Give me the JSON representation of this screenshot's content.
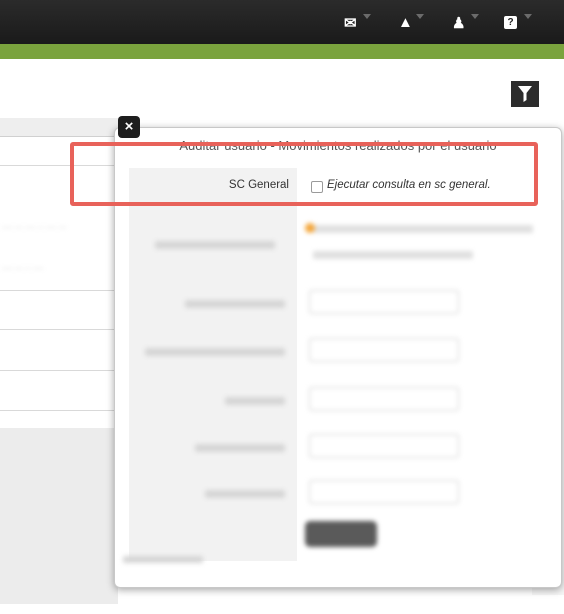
{
  "nav": {
    "icons": [
      "envelope-icon",
      "warning-icon",
      "bell-icon",
      "help-icon"
    ],
    "help_glyph": "?"
  },
  "colors": {
    "topbar": "#222222",
    "greenbar": "#7aa33d",
    "highlight": "#e8625a"
  },
  "modal": {
    "title": "Auditar usuario - Movimientos realizados por el usuario",
    "close_glyph": "×",
    "sc_general": {
      "label": "SC General",
      "checkbox_label": "Ejecutar consulta en sc general.",
      "checked": false
    }
  }
}
